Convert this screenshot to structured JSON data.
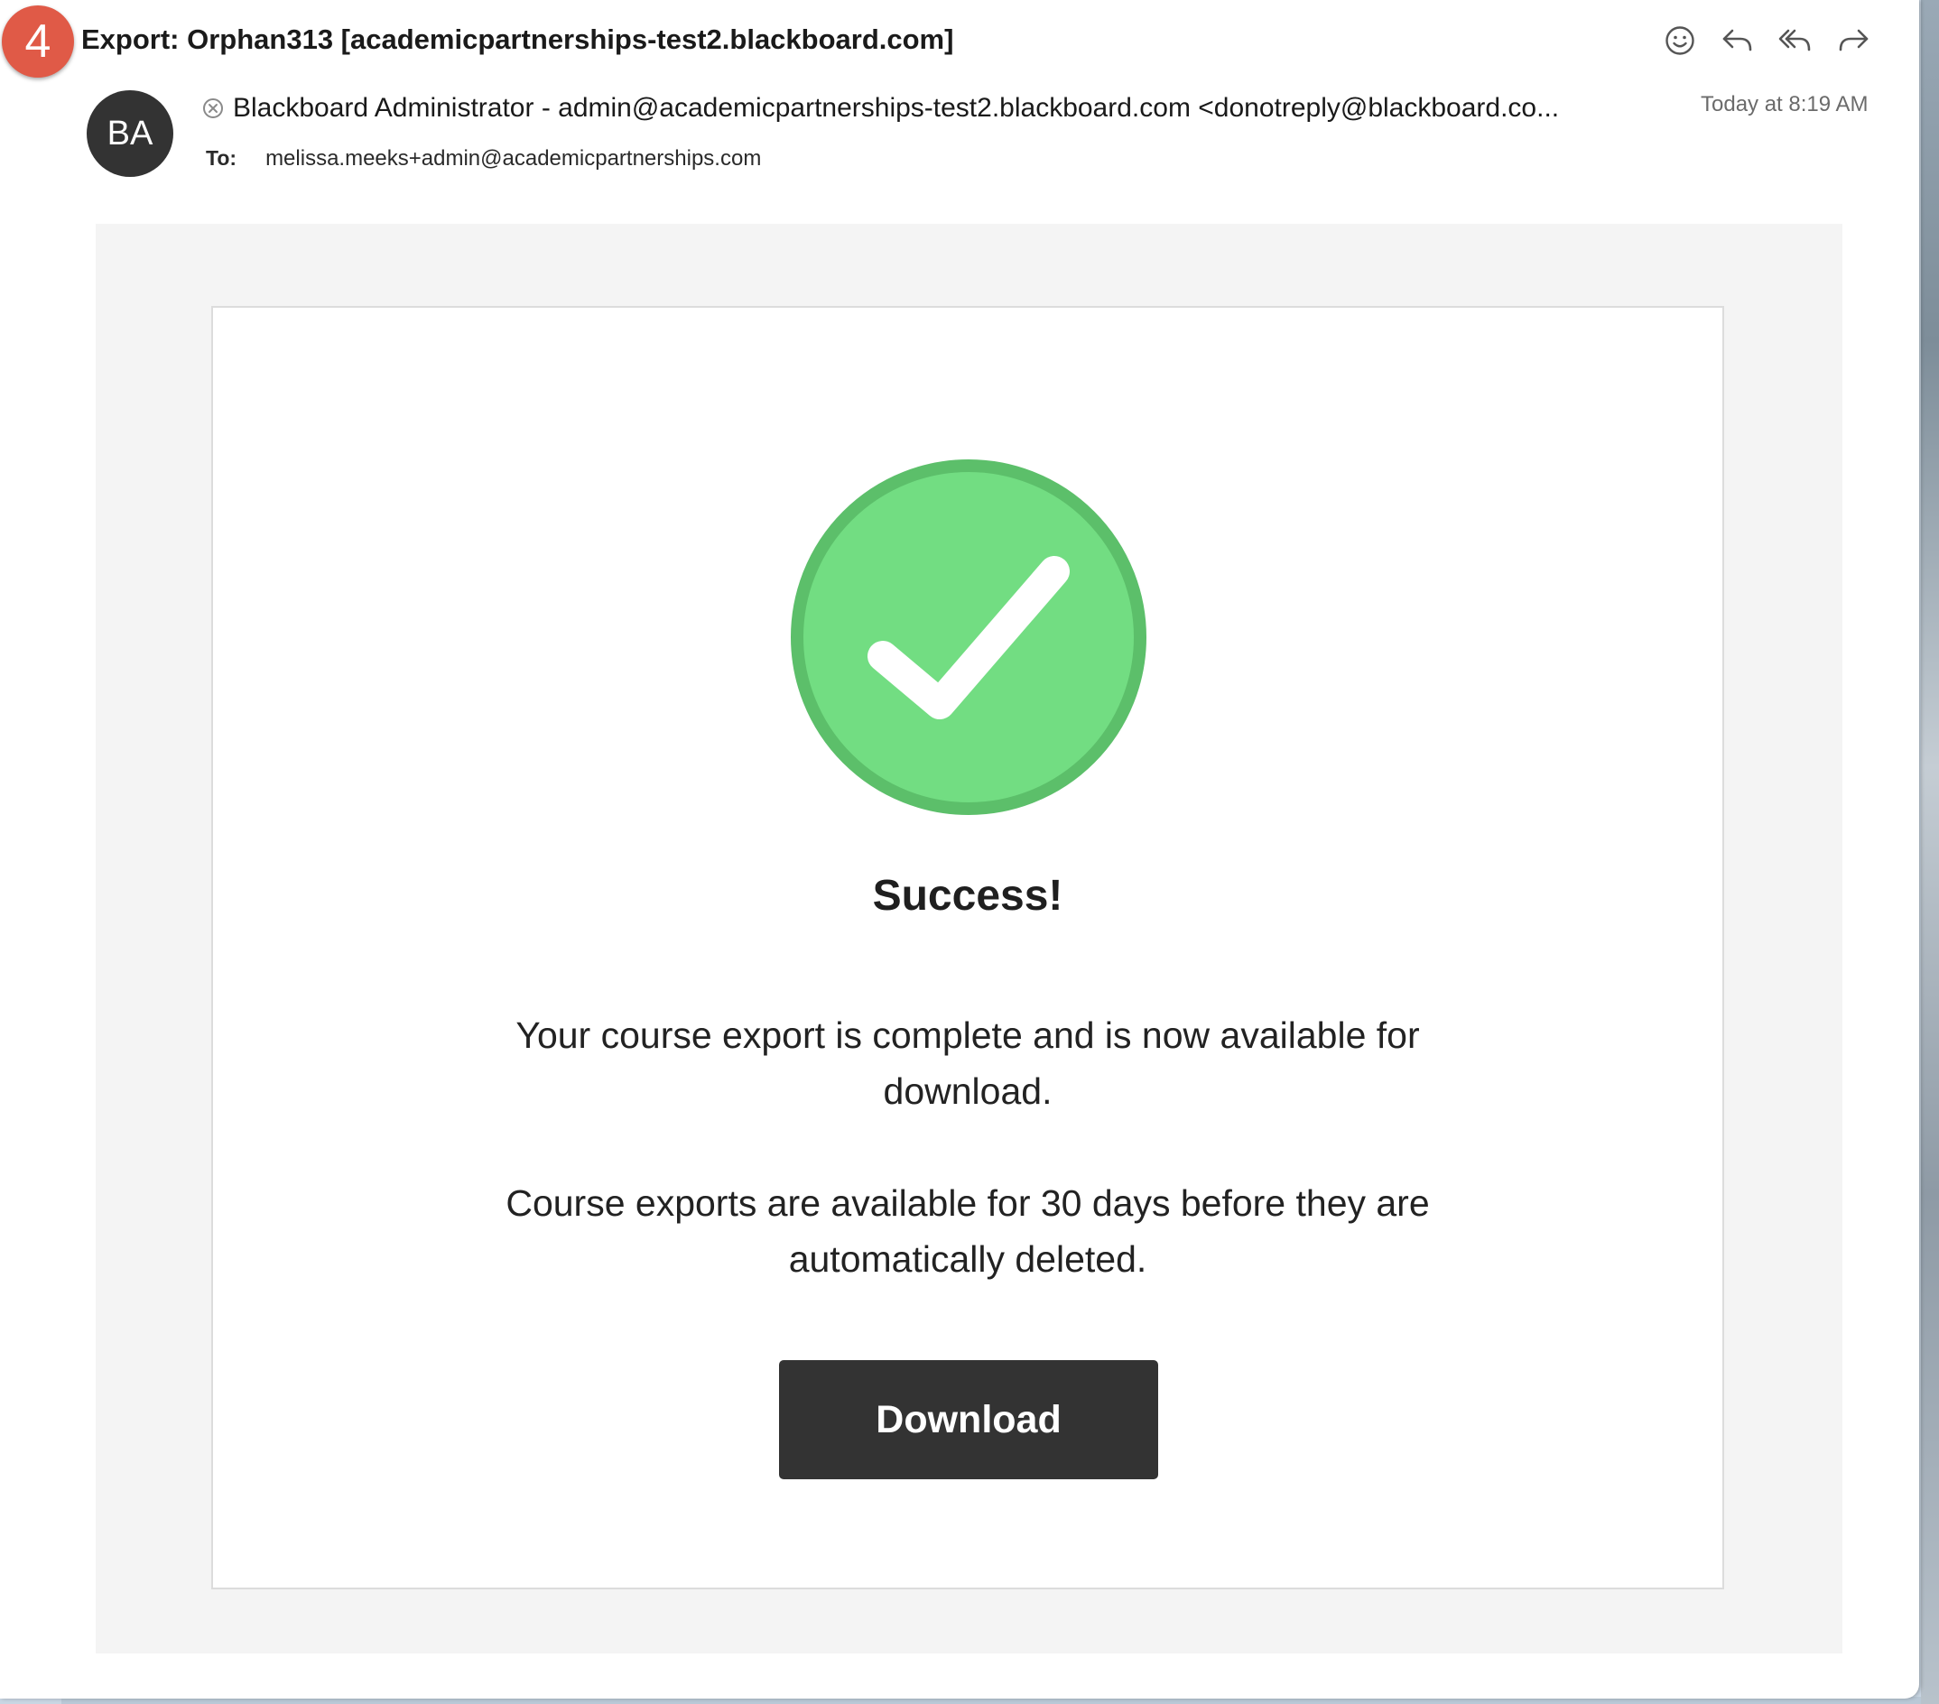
{
  "step_badge": "4",
  "email": {
    "subject": "Export: Orphan313 [academicpartnerships-test2.blackboard.com]",
    "sender_initials": "BA",
    "sender": "Blackboard Administrator - admin@academicpartnerships-test2.blackboard.com <donotreply@blackboard.co...",
    "date": "Today at 8:19 AM",
    "to_label": "To:",
    "to_address": "melissa.meeks+admin@academicpartnerships.com"
  },
  "toolbar": {
    "icons": [
      "emoji-icon",
      "reply-icon",
      "reply-all-icon",
      "forward-icon"
    ]
  },
  "body": {
    "title": "Success!",
    "paragraph1": [
      "Your course export is complete and is now available for",
      "download."
    ],
    "paragraph2": [
      "Course exports are available for 30 days before they are",
      "automatically deleted."
    ],
    "button_label": "Download"
  },
  "colors": {
    "badge": "#e05a47",
    "check_fill": "#72dd82",
    "check_ring": "#5cbf6a",
    "button": "#333333",
    "email_background": "#f4f4f4"
  }
}
